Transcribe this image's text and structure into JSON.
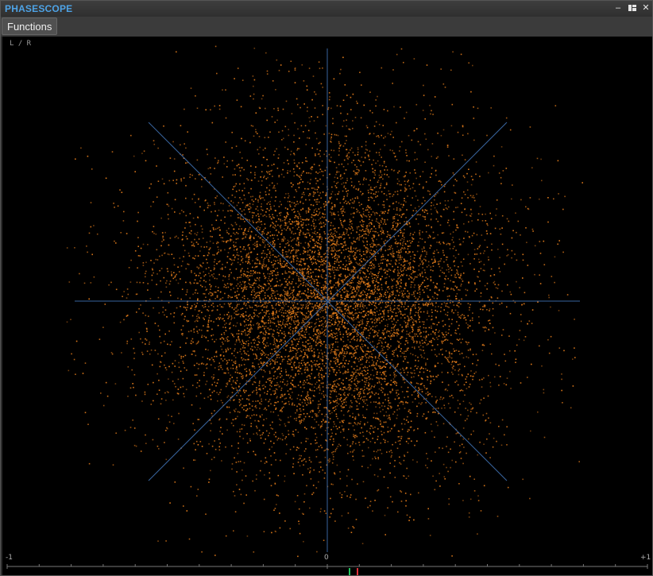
{
  "window": {
    "title": "PHASESCOPE",
    "buttons": {
      "minimize": "–",
      "layout_icon": "layout-icon",
      "close": "✕"
    }
  },
  "toolbar": {
    "functions_label": "Functions"
  },
  "scope": {
    "mode_label": "L / R",
    "axis": {
      "left": "-1",
      "center": "0",
      "right": "+1"
    },
    "colors": {
      "background": "#000000",
      "grid": "#3f6fb0",
      "dots": "#e07a1a",
      "balance_left": "#22c55e",
      "balance_right": "#e0303a"
    }
  }
}
